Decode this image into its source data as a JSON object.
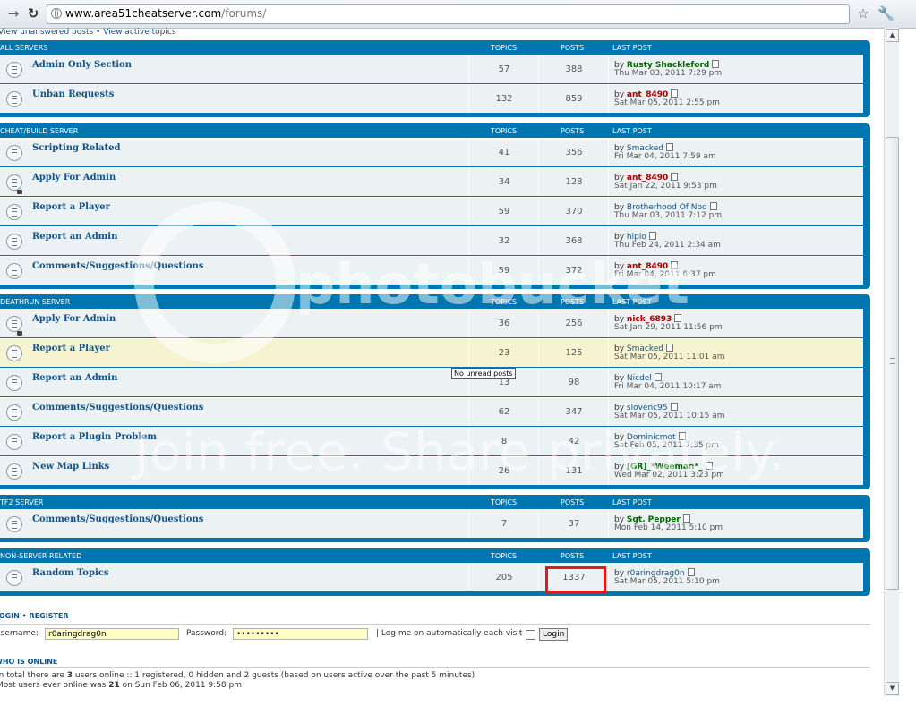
{
  "browser": {
    "url_host": "www.area51cheatserver.com",
    "url_path": "/forums/",
    "back_icon": "back-arrow-icon",
    "forward_icon": "forward-arrow-icon",
    "reload_icon": "reload-icon"
  },
  "toplinks": "View unanswered posts • View active topics",
  "columns": {
    "topics": "TOPICS",
    "posts": "POSTS",
    "last_post": "LAST POST"
  },
  "categories": [
    {
      "name": "ALL SERVERS",
      "forums": [
        {
          "title": "Admin Only Section",
          "topics": "57",
          "posts": "388",
          "by": "Rusty Shackleford",
          "by_color": "#006600",
          "date": "Thu Mar 03, 2011 7:29 pm",
          "locked": false
        },
        {
          "title": "Unban Requests",
          "topics": "132",
          "posts": "859",
          "by": "ant_8490",
          "by_color": "#aa0000",
          "date": "Sat Mar 05, 2011 2:55 pm",
          "locked": false
        }
      ]
    },
    {
      "name": "CHEAT/BUILD SERVER",
      "forums": [
        {
          "title": "Scripting Related",
          "topics": "41",
          "posts": "356",
          "by": "Smacked",
          "by_color": "#105289",
          "date": "Fri Mar 04, 2011 7:59 am",
          "locked": false
        },
        {
          "title": "Apply For Admin",
          "topics": "34",
          "posts": "128",
          "by": "ant_8490",
          "by_color": "#aa0000",
          "date": "Sat Jan 22, 2011 9:53 pm",
          "locked": true
        },
        {
          "title": "Report a Player",
          "topics": "59",
          "posts": "370",
          "by": "Brotherhood Of Nod",
          "by_color": "#105289",
          "date": "Thu Mar 03, 2011 7:12 pm",
          "locked": false
        },
        {
          "title": "Report an Admin",
          "topics": "32",
          "posts": "368",
          "by": "hipio",
          "by_color": "#105289",
          "date": "Thu Feb 24, 2011 2:34 am",
          "locked": false
        },
        {
          "title": "Comments/Suggestions/Questions",
          "topics": "59",
          "posts": "372",
          "by": "ant_8490",
          "by_color": "#aa0000",
          "date": "Fri Mar 04, 2011 6:37 pm",
          "locked": false
        }
      ]
    },
    {
      "name": "DEATHRUN SERVER",
      "forums": [
        {
          "title": "Apply For Admin",
          "topics": "36",
          "posts": "256",
          "by": "nick_6893",
          "by_color": "#aa0000",
          "date": "Sat Jan 29, 2011 11:56 pm",
          "locked": true
        },
        {
          "title": "Report a Player",
          "topics": "23",
          "posts": "125",
          "by": "Smacked",
          "by_color": "#105289",
          "date": "Sat Mar 05, 2011 11:01 am",
          "locked": false,
          "hover": true
        },
        {
          "title": "Report an Admin",
          "topics": "13",
          "posts": "98",
          "by": "Nicdel",
          "by_color": "#105289",
          "date": "Fri Mar 04, 2011 10:17 am",
          "locked": false
        },
        {
          "title": "Comments/Suggestions/Questions",
          "topics": "62",
          "posts": "347",
          "by": "slovenc95",
          "by_color": "#105289",
          "date": "Sat Mar 05, 2011 10:15 am",
          "locked": false
        },
        {
          "title": "Report a Plugin Problem",
          "topics": "8",
          "posts": "42",
          "by": "Dominicmot",
          "by_color": "#105289",
          "date": "Sat Feb 05, 2011 7:35 pm",
          "locked": false
        },
        {
          "title": "New Map Links",
          "topics": "26",
          "posts": "131",
          "by": "[GR]_*Weeman*_",
          "by_color": "#006600",
          "date": "Wed Mar 02, 2011 3:23 pm",
          "locked": false
        }
      ]
    },
    {
      "name": "TF2 SERVER",
      "forums": [
        {
          "title": "Comments/Suggestions/Questions",
          "topics": "7",
          "posts": "37",
          "by": "Sgt. Pepper",
          "by_color": "#006600",
          "date": "Mon Feb 14, 2011 5:10 pm",
          "locked": false
        }
      ]
    },
    {
      "name": "NON-SERVER RELATED",
      "forums": [
        {
          "title": "Random Topics",
          "topics": "205",
          "posts": "1337",
          "by": "r0aringdrag0n",
          "by_color": "#105289",
          "date": "Sat Mar 05, 2011 5:10 pm",
          "locked": false
        }
      ]
    }
  ],
  "tooltip": "No unread posts",
  "login": {
    "title": "LOGIN • REGISTER",
    "username_label": "Username:",
    "username_value": "r0aringdrag0n",
    "password_label": "Password:",
    "password_value": "•••••••••",
    "remember_label": "| Log me on automatically each visit",
    "button": "Login"
  },
  "who_is_online": {
    "title": "WHO IS ONLINE",
    "line1_prefix": "In total there are ",
    "line1_count": "3",
    "line1_suffix": " users online :: 1 registered, 0 hidden and 2 guests (based on users active over the past 5 minutes)",
    "line2_prefix": "Most users ever online was ",
    "line2_count": "21",
    "line2_suffix": " on Sun Feb 06, 2011 9:58 pm"
  },
  "watermark": {
    "brand": "photobucket",
    "tagline": "Join free. Share privately."
  },
  "colors": {
    "header_blue": "#0076b1",
    "link_blue": "#105289",
    "highlight": "#e01919"
  }
}
